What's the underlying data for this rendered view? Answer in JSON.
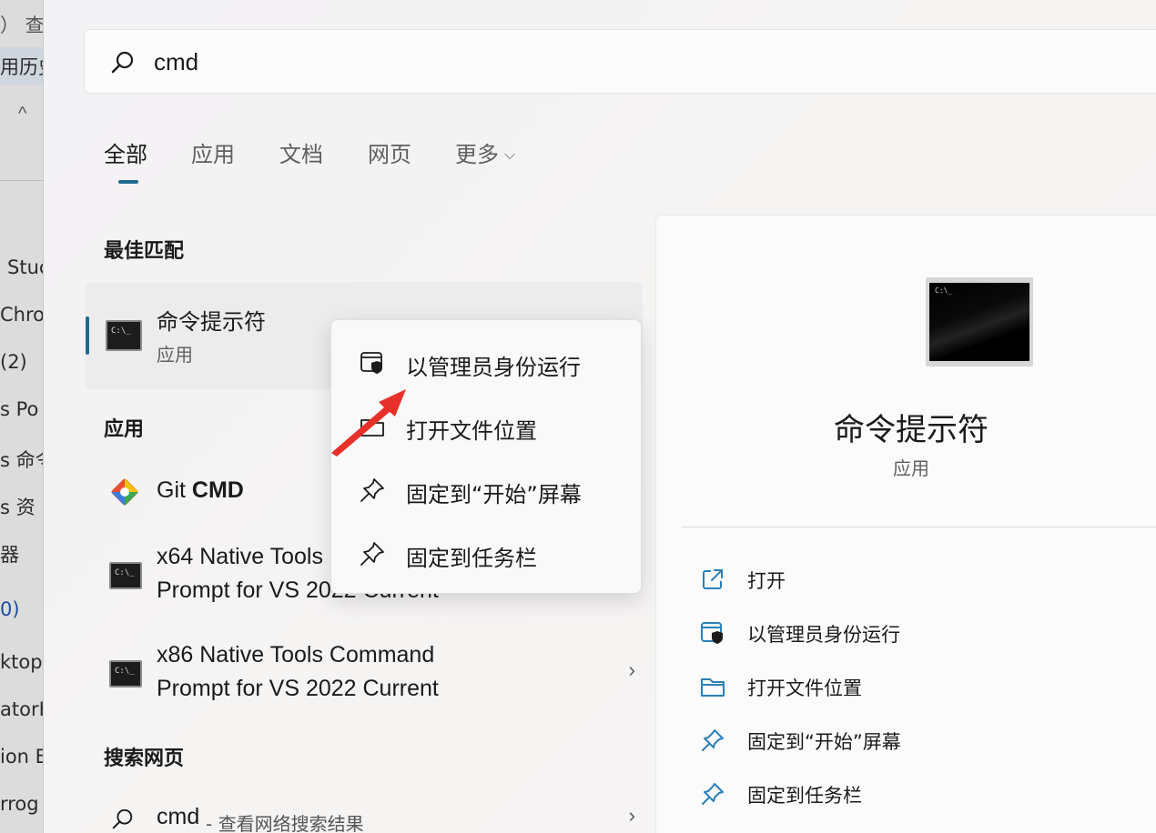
{
  "background_fragments": [
    "）  查",
    "用历史",
    "Stuc",
    "Chro",
    "(2)",
    "s Po",
    "s 命令",
    "s 资",
    "器",
    "0)",
    "ktopS",
    "atorH",
    "ion E",
    "rrog"
  ],
  "search": {
    "query": "cmd"
  },
  "tabs": [
    {
      "label": "全部",
      "active": true
    },
    {
      "label": "应用",
      "active": false
    },
    {
      "label": "文档",
      "active": false
    },
    {
      "label": "网页",
      "active": false
    },
    {
      "label": "更多",
      "active": false,
      "dropdown": true
    }
  ],
  "best_match": {
    "section_title": "最佳匹配",
    "name": "命令提示符",
    "type": "应用"
  },
  "apps": {
    "section_title": "应用",
    "items": [
      {
        "name_prefix": "Git ",
        "name_bold": "CMD",
        "icon": "git-icon"
      },
      {
        "line1": "x64 Native Tools Command",
        "line2": "Prompt for VS 2022 Current",
        "icon": "cmd-icon"
      },
      {
        "line1": "x86 Native Tools Command",
        "line2": "Prompt for VS 2022 Current",
        "icon": "cmd-icon",
        "has_chevron": true
      }
    ]
  },
  "web": {
    "section_title": "搜索网页",
    "query": "cmd",
    "description": "- 查看网络搜索结果"
  },
  "context_menu": [
    {
      "label": "以管理员身份运行",
      "icon": "shield-icon"
    },
    {
      "label": "打开文件位置",
      "icon": "folder-icon"
    },
    {
      "label": "固定到“开始”屏幕",
      "icon": "pin-icon"
    },
    {
      "label": "固定到任务栏",
      "icon": "pin-icon"
    }
  ],
  "detail": {
    "title": "命令提示符",
    "subtitle": "应用",
    "actions": [
      {
        "label": "打开",
        "icon": "open-external-icon"
      },
      {
        "label": "以管理员身份运行",
        "icon": "shield-icon"
      },
      {
        "label": "打开文件位置",
        "icon": "folder-icon"
      },
      {
        "label": "固定到“开始”屏幕",
        "icon": "pin-icon"
      },
      {
        "label": "固定到任务栏",
        "icon": "pin-icon"
      }
    ]
  },
  "colors": {
    "accent": "#1e6b8f",
    "annotation_arrow": "#e8302a",
    "icon_blue": "#2b7fb8"
  },
  "icons": {
    "search": "search-icon",
    "chevron_right": "›",
    "chevron_down": "⌵"
  }
}
